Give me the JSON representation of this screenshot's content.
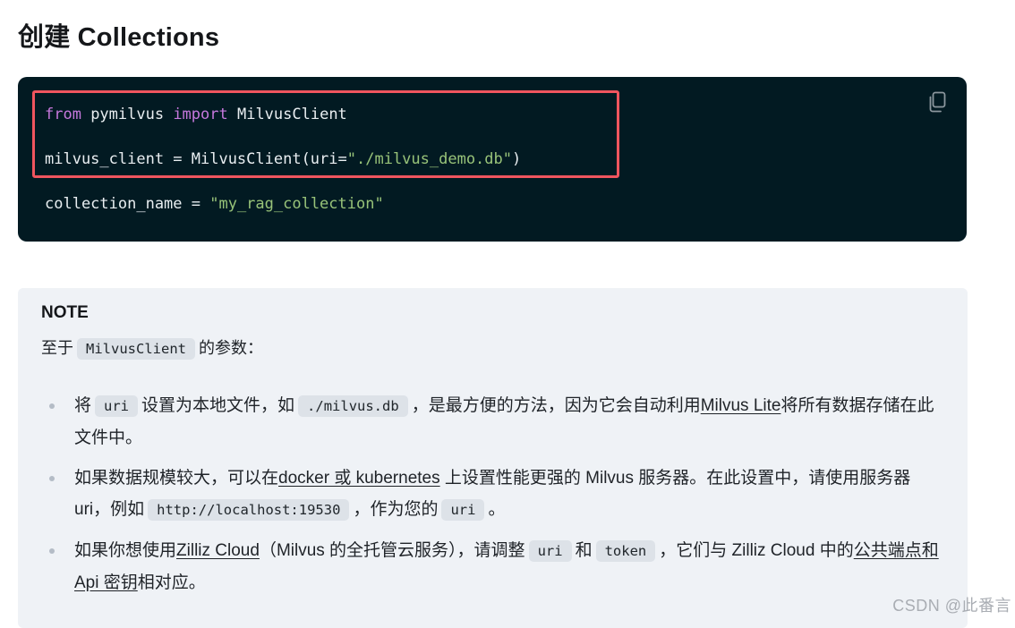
{
  "heading": {
    "title": "创建 Collections"
  },
  "code": {
    "line1": {
      "kw1": "from",
      "mid": " pymilvus ",
      "kw2": "import",
      "tail": " MilvusClient"
    },
    "line2": {
      "head": "milvus_client = MilvusClient(uri=",
      "str": "\"./milvus_demo.db\"",
      "tail": ")"
    },
    "line3": {
      "head": "collection_name = ",
      "str": "\"my_rag_collection\""
    },
    "copy_icon": "copy-icon",
    "highlight_color": "#f0555e",
    "background_color": "#021a22"
  },
  "note": {
    "title": "NOTE",
    "intro": {
      "pre": "至于",
      "code": "MilvusClient",
      "post": "的参数："
    },
    "bullets": [
      {
        "t1": "将",
        "c1": "uri",
        "t2": "设置为本地文件，如",
        "c2": "./milvus.db",
        "t3": "，是最方便的方法，因为它会自动利用",
        "l1": "Milvus Lite",
        "t4": "将所有数据存储在此文件中。"
      },
      {
        "t1": "如果数据规模较大，可以在",
        "l1": "docker 或 kubernetes",
        "t2": " 上设置性能更强的 Milvus 服务器。在此设置中，请使用服务器 uri，例如",
        "c1": "http://localhost:19530",
        "t3": "，作为您的",
        "c2": "uri",
        "t4": "。"
      },
      {
        "t1": "如果你想使用",
        "l1": "Zilliz Cloud",
        "t2": "（Milvus 的全托管云服务），请调整",
        "c1": "uri",
        "t3": "和",
        "c2": "token",
        "t4": "，它们与 Zilliz Cloud 中的",
        "l2": "公共端点和 Api 密钥",
        "t5": "相对应。"
      }
    ]
  },
  "watermark": "CSDN @此番言"
}
